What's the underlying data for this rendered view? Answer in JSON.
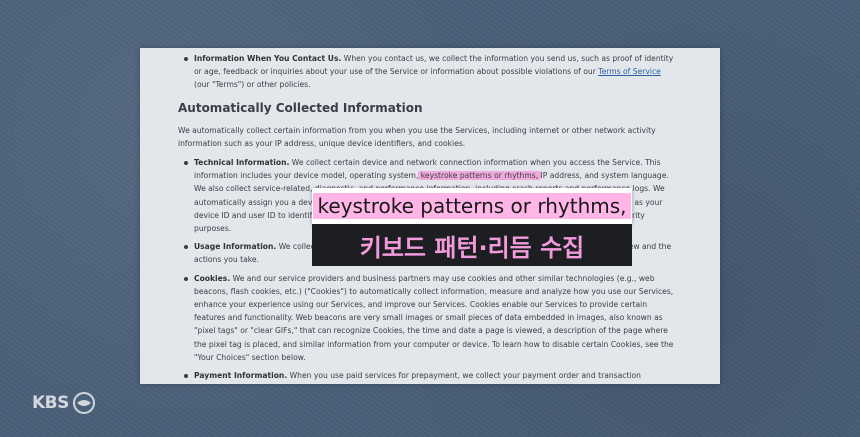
{
  "document": {
    "contact_item": {
      "title": "Information When You Contact Us.",
      "text_before_link": " When you contact us, we collect the information you send us, such as proof of identity or age, feedback or inquiries about your use of the Service or information about possible violations of our ",
      "link_text": "Terms of Service",
      "text_after_link": " (our \"Terms\") or other policies."
    },
    "section_heading": "Automatically Collected Information",
    "section_intro": "We automatically collect certain information from you when you use the Services, including internet or other network activity information such as your IP address, unique device identifiers, and cookies.",
    "technical_item": {
      "title": "Technical Information.",
      "text_before_highlight": " We collect certain device and network connection information when you access the Service. This information includes your device model, operating system,",
      "highlight": " keystroke patterns or rhythms, ",
      "text_after_highlight": "IP address, and system language. We also collect service-related, diagnostic, and performance information, including crash reports and performance logs. We automatically assign you a device ID and user ID. Where you log in from multiple devices, we use information such as your device ID and user ID to identify your activity across devices to give you a seamless log-in experience and for security purposes."
    },
    "usage_item": {
      "title": "Usage Information.",
      "text": " We collect information about how you engage with the Service, including the content you view and the actions you take."
    },
    "cookies_item": {
      "title": "Cookies.",
      "text": " We and our service providers and business partners may use cookies and other similar technologies (e.g., web beacons, flash cookies, etc.) (\"Cookies\") to automatically collect information, measure and analyze how you use our Services, enhance your experience using our Services, and improve our Services. Cookies enable our Services to provide certain features and functionality. Web beacons are very small images or small pieces of data embedded in images, also known as \"pixel tags\" or \"clear GIFs,\" that can recognize Cookies, the time and date a page is viewed, a description of the page where the pixel tag is placed, and similar information from your computer or device. To learn how to disable certain Cookies, see the \"Your Choices\" section below."
    },
    "payment_item": {
      "title": "Payment Information.",
      "text": " When you use paid services for prepayment, we collect your payment order and transaction information to provide services such as order placement, payment, customer service, and after-sales support."
    }
  },
  "caption": {
    "english": "keystroke patterns or rhythms,",
    "korean": "키보드 패턴·리듬 수집"
  },
  "broadcaster_logo": "KBS",
  "colors": {
    "highlight": "#ff78d2",
    "caption_korean": "#f29bdc",
    "link": "#2a5fa8"
  }
}
